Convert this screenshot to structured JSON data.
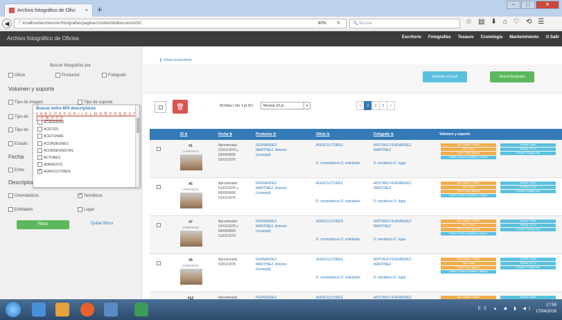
{
  "browser": {
    "tab_title": "Archivo fotográfico de Ofici",
    "tab_close": "×",
    "new_tab": "+",
    "url": "localhost/archivo/ver/fotografias/pagina/1/orden/id/direccion/ASC",
    "zoom": "80%",
    "search_placeholder": "Buscar",
    "win_min": "–",
    "win_max": "□",
    "win_close": "✕"
  },
  "app": {
    "title": "Archivo fotográfico de Oficios",
    "nav": [
      "Escritorio",
      "Fotografías",
      "Tesauro",
      "Cronología",
      "Mantenimiento",
      "⏻ Salir"
    ]
  },
  "sidebar": {
    "buscar_title": "Buscar fotografías por",
    "top_checks": [
      {
        "label": "Oficio",
        "checked": false
      },
      {
        "label": "Productor",
        "checked": false
      },
      {
        "label": "Fotógrafo",
        "checked": false
      }
    ],
    "volumen_title": "Volumen y soporte",
    "vol_checks": [
      {
        "label": "Tipo de imagen",
        "checked": false
      },
      {
        "label": "Tipo de soporte",
        "checked": false
      },
      {
        "label": "Tipo de",
        "checked": false
      },
      {
        "label": "Tipo de",
        "checked": false
      },
      {
        "label": "Estado",
        "checked": false
      }
    ],
    "fecha_title": "Fecha",
    "entre_label": "Entre",
    "descrip_title": "Descriptores",
    "desc_checks": [
      {
        "label": "Onomásticos",
        "checked": false
      },
      {
        "label": "Temáticos",
        "checked": true
      },
      {
        "label": "Entidades",
        "checked": false
      },
      {
        "label": "Lugar",
        "checked": false
      }
    ],
    "filtrar": "Filtrar",
    "quitar": "Quitar filtros"
  },
  "popup": {
    "title": "Buscar entre 604 descriptores",
    "alphabet": "# A B C D E F G H I J K L M N Ñ O P Q R S T U V W X Y Z",
    "items": [
      {
        "label": "ACADEMIAS",
        "checked": false
      },
      {
        "label": "ACEITES",
        "checked": false
      },
      {
        "label": "ACEITUNAS",
        "checked": false
      },
      {
        "label": "ACORDEONES",
        "checked": false
      },
      {
        "label": "ACORDEONISTAS",
        "checked": false
      },
      {
        "label": "ACTORES",
        "checked": false
      },
      {
        "label": "ADEREZOS",
        "checked": false
      },
      {
        "label": "AGRICULTORES",
        "checked": true
      }
    ]
  },
  "main": {
    "volver": "❮ Volver al escritorio",
    "exportar": "Exportar a Excel",
    "nueva": "Nueva fotografía",
    "delete_icon": "🗑",
    "count": "55 fotos | Ver 1 al 20 |",
    "perpage": "Mostrar 20 pr",
    "perpage_arrow": "▾",
    "pages": [
      "«",
      "1",
      "2",
      "3",
      "»"
    ],
    "headers": {
      "id": "ID ⇅",
      "fecha": "Fecha ⇅",
      "productor": "Productor ⇅",
      "oficio": "Oficio ⇅",
      "fotografo": "Fotógrafo ⇅",
      "volumen": "Volumen y soporte"
    },
    "rows": [
      {
        "num": "#1",
        "code": "(ADRI0461)",
        "fecha": "Aproximada: 01/01/1976 y 00/00/0000 01/01/1976",
        "productor": "FERNÁNDEZ MARTÍNEZ, Antonio (consejal)",
        "oficio": "AGRICULTORES",
        "oficio_sub": "D. onomásticos  D. entidades",
        "fotografo": "ANTONIO FERNÁNDEZ MARTÍNEZ",
        "foto_sub": "D. temáticos  D. lugar"
      },
      {
        "num": "#5",
        "code": "(ADRI0002)",
        "fecha": "Aproximada: 01/01/1976 y 00/00/0000 01/01/1976",
        "productor": "FERNÁNDEZ MARTÍNEZ, Antonio (consejal)",
        "oficio": "AGRICULTORES",
        "oficio_sub": "D. onomásticos  D. entidades",
        "fotografo": "ANTONIO FERNÁNDEZ MARTÍNEZ",
        "foto_sub": "D. temáticos  D. lugar"
      },
      {
        "num": "#7",
        "code": "(ADRI0003)",
        "fecha": "Aproximada: 01/01/1976 y 00/00/0000 01/01/1976",
        "productor": "FERNÁNDEZ MARTÍNEZ, Antonio (consejal)",
        "oficio": "AGRICULTORES",
        "oficio_sub": "D. onomásticos  D. entidades",
        "fotografo": "ANTONIO FERNÁNDEZ MARTÍNEZ",
        "foto_sub": "D. temáticos  D. lugar"
      },
      {
        "num": "#9",
        "code": "(ADRI0006)",
        "fecha": "Aproximada: 01/01/1976",
        "productor": "FERNÁNDEZ MARTÍNEZ, Antonio (consejal)",
        "oficio": "AGRICULTORES",
        "oficio_sub": "D. onomásticos  D. entidades",
        "fotografo": "ANTONIO FERNÁNDEZ MARTÍNEZ",
        "foto_sub": "D. temáticos  D. lugar"
      },
      {
        "num": "#12",
        "code": "",
        "fecha": "Aproximada:",
        "productor": "FERNÁNDEZ",
        "oficio": "AGRICULTORES",
        "oficio_sub": "",
        "fotografo": "ANTONIO FERNÁNDEZ MARTÍNEZ",
        "foto_sub": ""
      }
    ],
    "pills": {
      "tipo": "Tipo imagen: Positivo",
      "tono": "Tono: Color",
      "plano": "Plano: Plano general",
      "estado": "Estado: Estado aceptable o antiguo",
      "soporte": "Soporte: Papel",
      "tamano": "Tamaño: 10 x 8",
      "formato": "Formato: Paisaje rural"
    }
  },
  "taskbar": {
    "time": "17:59",
    "date": "17/04/2018",
    "tray": "ES ▲ ◆ ▮ ◀)"
  }
}
